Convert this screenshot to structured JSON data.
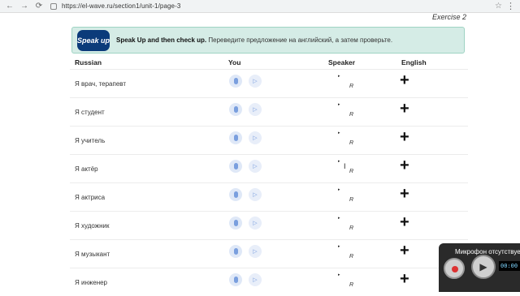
{
  "browser": {
    "url": "https://el-wave.ru/section1/unit-1/page-3",
    "back": "←",
    "forward": "→",
    "reload": "⟳",
    "star": "☆",
    "menu": "⋮"
  },
  "exercise": {
    "title": "Exercise 2"
  },
  "banner": {
    "logo": "Speak up",
    "bold": "Speak Up and then check up.",
    "text": " Переведите предложение на английский, а затем проверьте."
  },
  "table": {
    "headers": {
      "russian": "Russian",
      "you": "You",
      "speaker": "Speaker",
      "english": "English"
    },
    "rows": [
      {
        "ru": "Я врач, терапевт"
      },
      {
        "ru": "Я студент"
      },
      {
        "ru": "Я учитель"
      },
      {
        "ru": "Я актёр"
      },
      {
        "ru": "Я актриса"
      },
      {
        "ru": "Я художник"
      },
      {
        "ru": "Я музыкант"
      },
      {
        "ru": "Я инженер"
      }
    ],
    "speaker_glyph": "▸",
    "speaker_label": "R",
    "play_glyph": "▷",
    "plus_glyph": "+"
  },
  "recorder": {
    "title": "Микрофон отсутствует",
    "time": "00:00",
    "play": "▶"
  },
  "cursor": "I"
}
